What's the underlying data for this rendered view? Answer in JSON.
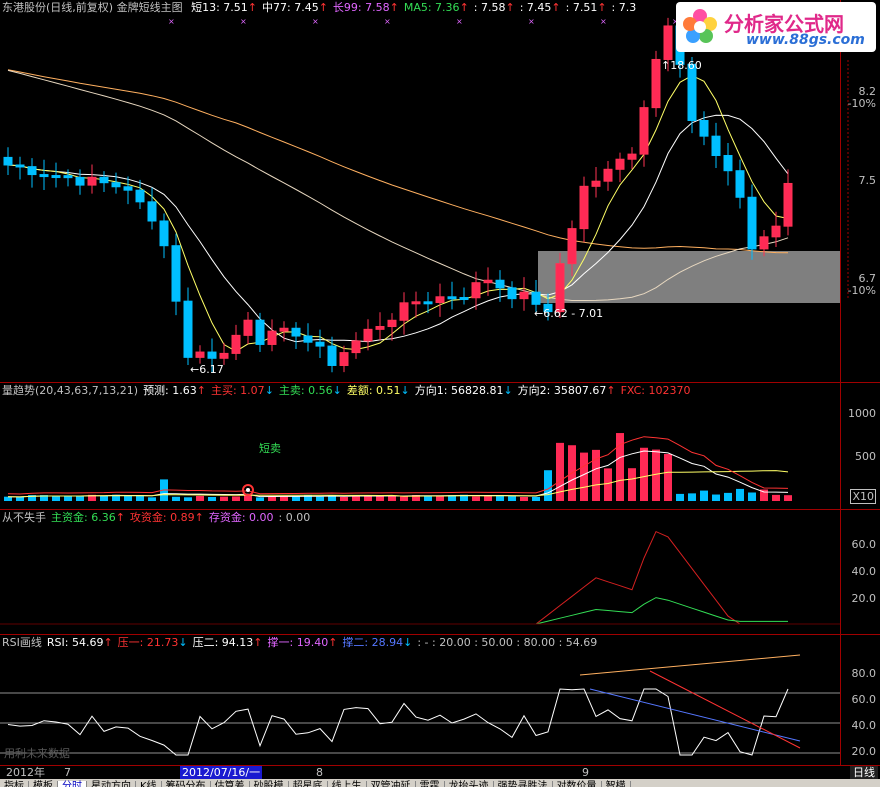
{
  "colors": {
    "up": "#ff3355",
    "down": "#00bfff",
    "white": "#ffffff",
    "yellow": "#ffff66",
    "orange": "#ffb060",
    "gray": "#c0c0c0",
    "green": "#33dd55",
    "purple": "#e066ff",
    "red": "#ff3333",
    "blue": "#5577ff"
  },
  "main": {
    "title": "东港股份(日线,前复权) 金牌短线主图",
    "indicators": [
      {
        "label": "短13: 7.51",
        "color": "#ffffff",
        "arrow": "↑"
      },
      {
        "label": "中77: 7.45",
        "color": "#ffffff",
        "arrow": "↑"
      },
      {
        "label": "长99: 7.58",
        "color": "#e066ff",
        "arrow": "↑"
      },
      {
        "label": "MA5: 7.36",
        "color": "#33dd55",
        "arrow": "↑"
      },
      {
        "label": ": 7.58",
        "color": "#ffffff",
        "arrow": "↑"
      },
      {
        "label": ": 7.45",
        "color": "#ffffff",
        "arrow": "↑"
      },
      {
        "label": ": 7.51",
        "color": "#ffffff",
        "arrow": "↑"
      },
      {
        "label": ": 7.3",
        "color": "#ffffff",
        "arrow": ""
      }
    ],
    "y_labels": [
      "8.2",
      "-10%",
      "7.5",
      "6.7",
      "-10%"
    ],
    "annotations": {
      "high": "18.60",
      "low": "6.17",
      "range": "6.62 - 7.01"
    }
  },
  "logo": {
    "line1": "分析家公式网",
    "line2": "www.88gs.com"
  },
  "volume": {
    "header": [
      {
        "label": "量趋势(20,43,63,7,13,21)",
        "color": "#c0c0c0",
        "arrow": ""
      },
      {
        "label": "预测: 1.63",
        "color": "#ffffff",
        "arrow": "↑"
      },
      {
        "label": "主买: 1.07",
        "color": "#ff3333",
        "arrow": "↓"
      },
      {
        "label": "主卖: 0.56",
        "color": "#33dd55",
        "arrow": "↓"
      },
      {
        "label": "差额: 0.51",
        "color": "#ffff66",
        "arrow": "↓"
      },
      {
        "label": "方向1: 56828.81",
        "color": "#ffffff",
        "arrow": "↓"
      },
      {
        "label": "方向2: 35807.67",
        "color": "#ffffff",
        "arrow": "↑"
      },
      {
        "label": "FXC: 102370",
        "color": "#ff3333",
        "arrow": ""
      }
    ],
    "y_labels": [
      "1000",
      "500",
      "X10"
    ],
    "signal": "短卖"
  },
  "fund": {
    "header": [
      {
        "label": "从不失手",
        "color": "#c0c0c0",
        "arrow": ""
      },
      {
        "label": "主资金: 6.36",
        "color": "#33dd55",
        "arrow": "↑"
      },
      {
        "label": "攻资金: 0.89",
        "color": "#ff3333",
        "arrow": "↑"
      },
      {
        "label": "存资金: 0.00",
        "color": "#e066ff",
        "arrow": ""
      },
      {
        "label": ": 0.00",
        "color": "#c0c0c0",
        "arrow": ""
      }
    ],
    "y_labels": [
      "60.0",
      "40.0",
      "20.0"
    ]
  },
  "rsi": {
    "header": [
      {
        "label": "RSI画线",
        "color": "#c0c0c0",
        "arrow": ""
      },
      {
        "label": "RSI: 54.69",
        "color": "#ffffff",
        "arrow": "↑"
      },
      {
        "label": "压一: 21.73",
        "color": "#ff3333",
        "arrow": "↓"
      },
      {
        "label": "压二: 94.13",
        "color": "#ffffff",
        "arrow": "↑"
      },
      {
        "label": "撑一: 19.40",
        "color": "#e066ff",
        "arrow": "↑"
      },
      {
        "label": "撑二: 28.94",
        "color": "#5577ff",
        "arrow": "↓"
      },
      {
        "label": ": - : 20.00 : 50.00 : 80.00 : 54.69",
        "color": "#c0c0c0",
        "arrow": ""
      }
    ],
    "y_labels": [
      "80.0",
      "60.0",
      "40.0",
      "20.0"
    ],
    "watermark": "用利未来数据"
  },
  "timebar": {
    "ticks": [
      {
        "label": "2012年",
        "pos": 6,
        "selected": false
      },
      {
        "label": "7",
        "pos": 64,
        "selected": false
      },
      {
        "label": "2012/07/16/一",
        "pos": 180,
        "selected": true
      },
      {
        "label": "8",
        "pos": 316,
        "selected": false
      },
      {
        "label": "9",
        "pos": 582,
        "selected": false
      }
    ],
    "right_label": "日线"
  },
  "tabs": [
    "指标",
    "模板",
    "分时",
    "星动方向",
    "K线",
    "筹码分布",
    "估算差",
    "砂股模",
    "超星底",
    "线上生",
    "双管冲延",
    "雷霆",
    "龙抬头迹",
    "强势寻胜法",
    "对数价量",
    "智横"
  ]
}
